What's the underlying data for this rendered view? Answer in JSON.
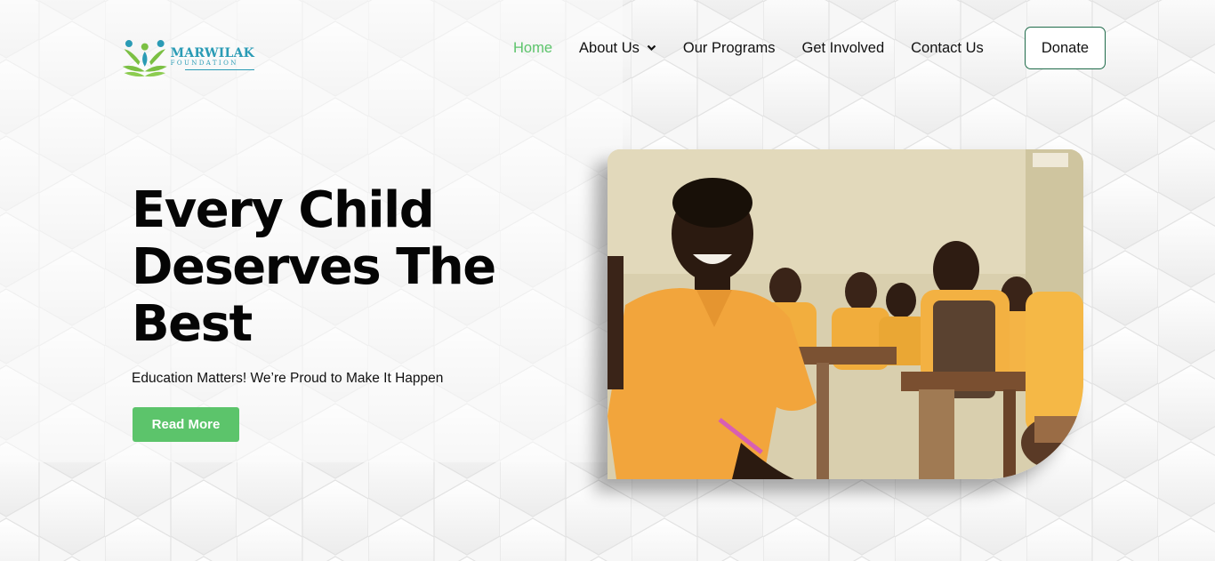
{
  "brand": {
    "name": "MARWILAK",
    "sub": "FOUNDATION",
    "colors": {
      "teal": "#2a9bb5",
      "green": "#7bc043",
      "accent": "#5cc46b"
    }
  },
  "nav": {
    "items": [
      {
        "label": "Home",
        "active": true
      },
      {
        "label": "About Us",
        "has_dropdown": true
      },
      {
        "label": "Our Programs"
      },
      {
        "label": "Get Involved"
      },
      {
        "label": "Contact Us"
      }
    ],
    "donate_label": "Donate"
  },
  "hero": {
    "title_line1": "Every Child",
    "title_line2": "Deserves The",
    "title_line3": "Best",
    "subtitle": "Education Matters! We’re Proud to Make It Happen",
    "cta_label": "Read More",
    "image_icon": "classroom-photo"
  }
}
